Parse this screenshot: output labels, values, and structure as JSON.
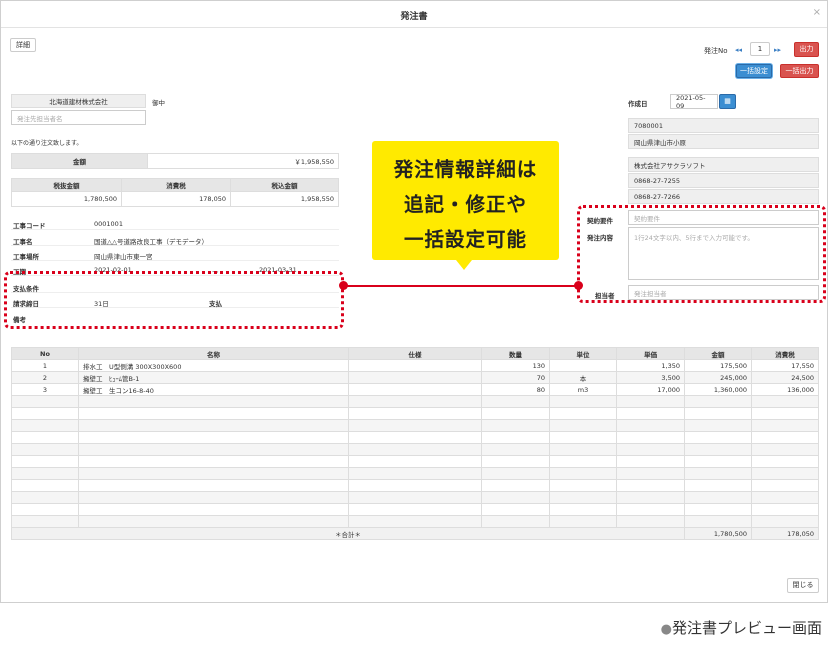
{
  "window": {
    "title": "発注書",
    "close_glyph": "×"
  },
  "toolbar": {
    "detail_button": "詳細",
    "order_no_label": "発注No",
    "prev_glyph": "◂◂",
    "next_glyph": "▸▸",
    "order_no_value": "1",
    "output_button": "出力",
    "bulk_settings_button": "一括設定",
    "bulk_output_button": "一括出力"
  },
  "recipient": {
    "company": "北海道建材株式会社",
    "honorific": "御中",
    "contact_placeholder": "発注先担当者名",
    "intro": "以下の通り注文致します。"
  },
  "amount": {
    "label": "金額",
    "value": "￥1,958,550"
  },
  "tax_summary": {
    "headers": [
      "税抜金額",
      "消費税",
      "税込金額"
    ],
    "values": [
      "1,780,500",
      "178,050",
      "1,958,550"
    ]
  },
  "project": {
    "rows": [
      {
        "key": "工事コード",
        "value": "0001001"
      },
      {
        "key": "工事名",
        "value": "国道△△号道路改良工事（デモデータ）"
      },
      {
        "key": "工事場所",
        "value": "岡山県津山市東一宮"
      },
      {
        "key": "工期",
        "value": "2021-02-01"
      }
    ],
    "period_sep": "〜",
    "period_end": "2021-03-31",
    "payment_terms_label": "支払条件",
    "billing_close_label": "請求締日",
    "billing_close_value": "31日",
    "payment_label": "支払",
    "remarks_label": "備考"
  },
  "issuer": {
    "created_label": "作成日",
    "created_date": "2021-05-09",
    "calendar_icon": "▦",
    "postal": "7080001",
    "address": "岡山県津山市小原",
    "company": "株式会社アサクラソフト",
    "tel": "0868-27-7255",
    "fax": "0868-27-7266",
    "contract_label": "契約要件",
    "contract_placeholder": "契約要件",
    "order_content_label": "発注内容",
    "order_content_placeholder": "1行24文字以内、5行まで入力可能です。",
    "person_label": "担当者",
    "person_placeholder": "発注担当者"
  },
  "items_table": {
    "headers": [
      "No",
      "名称",
      "仕様",
      "数量",
      "単位",
      "単価",
      "金額",
      "消費税"
    ],
    "rows": [
      [
        "1",
        "排水工　U型側溝 300X300X600",
        "",
        "130",
        "",
        "1,350",
        "175,500",
        "17,550"
      ],
      [
        "2",
        "擁壁工　ﾋｭｰﾑ管B-1",
        "",
        "70",
        "本",
        "3,500",
        "245,000",
        "24,500"
      ],
      [
        "3",
        "擁壁工　生コン16-8-40",
        "",
        "80",
        "m3",
        "17,000",
        "1,360,000",
        "136,000"
      ]
    ],
    "total_label": "＊合計＊",
    "total_amount": "1,780,500",
    "total_tax": "178,050"
  },
  "footer": {
    "close_button": "閉じる"
  },
  "callout": {
    "lines": [
      "発注情報詳細は",
      "追記・修正や",
      "一括設定可能"
    ]
  },
  "caption": {
    "bullet": "●",
    "text": "発注書プレビュー画面"
  },
  "colors": {
    "accent_red": "#d9001b",
    "callout_yellow": "#ffea00",
    "button_red": "#d9534f",
    "button_blue": "#3b8ed2"
  }
}
